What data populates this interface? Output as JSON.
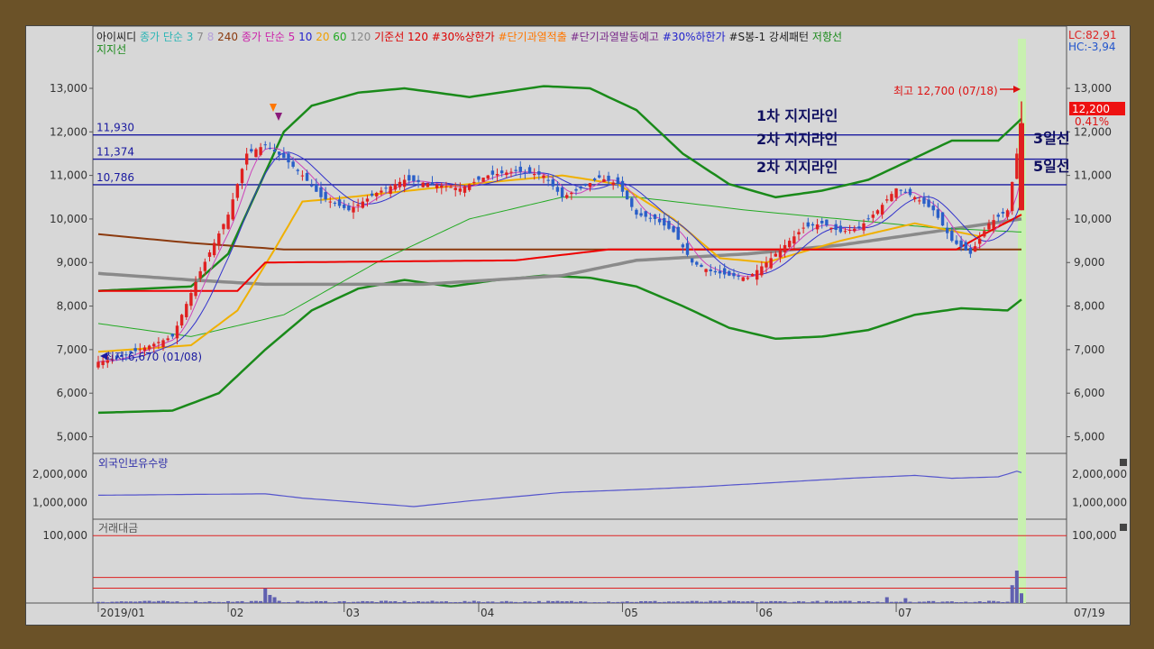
{
  "legend": {
    "items": [
      {
        "text": "아이씨디",
        "color": "#222222"
      },
      {
        "text": "종가 단순 3",
        "color": "#2db6b6"
      },
      {
        "text": "7",
        "color": "#8a8a8a"
      },
      {
        "text": "8",
        "color": "#b5a0d8"
      },
      {
        "text": "240",
        "color": "#8b3a0e"
      },
      {
        "text": "종가 단순 5",
        "color": "#cc22aa"
      },
      {
        "text": "10",
        "color": "#2222cc"
      },
      {
        "text": "20",
        "color": "#f0a000"
      },
      {
        "text": "60",
        "color": "#22aa22"
      },
      {
        "text": "120",
        "color": "#888888"
      },
      {
        "text": "기준선 120",
        "color": "#dd0000"
      },
      {
        "text": "#30%상한가",
        "color": "#dd0000"
      },
      {
        "text": "#단기과열적출",
        "color": "#ff7700"
      },
      {
        "text": "#단기과열발동예고",
        "color": "#7a2a8a"
      },
      {
        "text": "#30%하한가",
        "color": "#2222cc"
      },
      {
        "text": "#S봉-1 강세패턴",
        "color": "#222222"
      },
      {
        "text": "저항선",
        "color": "#1a8a1a"
      }
    ],
    "line2": "지지선",
    "line2_color": "#1a8a1a"
  },
  "lc_hc": {
    "lc": "LC:82,91",
    "hc": "HC:-3,94"
  },
  "price_tag": {
    "price": "12,200",
    "pct": "0.41%"
  },
  "annotations": {
    "high": "최고 12,700 (07/18)",
    "low": "최저 6,670 (01/08)",
    "support1": "1차 지지라인",
    "support2a": "2차 지지라인",
    "support2b": "2차 지지라인",
    "ma3": "3일선",
    "ma5": "5일선"
  },
  "colors": {
    "up": "#e02020",
    "down": "#2a5fc8",
    "bollinger": "#1a8a1a",
    "hline": "#1a1aa0",
    "highlight": "#c8f0b0",
    "ma240": "#8b3a0e",
    "ma120": "#8a8a8a",
    "ma20": "#f0b000",
    "ma60": "#22aa22",
    "ma10": "#3333cc",
    "ma5": "#cc44bb",
    "base": "#ee0000",
    "foreign": "#5555cc",
    "volume": "#6060b0"
  },
  "chart_data": [
    {
      "type": "candlestick",
      "title": "아이씨디",
      "ylim": [
        4700,
        13600
      ],
      "yticks": [
        "13,000",
        "12,000",
        "11,000",
        "10,000",
        "9,000",
        "8,000",
        "7,000",
        "6,000",
        "5,000"
      ],
      "ytick_values": [
        13000,
        12000,
        11000,
        10000,
        9000,
        8000,
        7000,
        6000,
        5000
      ],
      "xticks": [
        "2019/01",
        "02",
        "03",
        "04",
        "05",
        "06",
        "07"
      ],
      "right_xtick": "07/19",
      "support_levels": [
        {
          "label": "11,930",
          "value": 11930
        },
        {
          "label": "11,374",
          "value": 11374
        },
        {
          "label": "10,786",
          "value": 10786
        }
      ],
      "last_price": 12200,
      "high": 12700,
      "low": 6670,
      "close_series_waypoints": [
        [
          0,
          6720
        ],
        [
          4,
          6800
        ],
        [
          10,
          7050
        ],
        [
          16,
          7300
        ],
        [
          22,
          8800
        ],
        [
          28,
          10100
        ],
        [
          32,
          11500
        ],
        [
          36,
          11700
        ],
        [
          40,
          11400
        ],
        [
          44,
          11000
        ],
        [
          48,
          10500
        ],
        [
          54,
          10200
        ],
        [
          60,
          10600
        ],
        [
          66,
          10900
        ],
        [
          72,
          10800
        ],
        [
          78,
          10700
        ],
        [
          84,
          11000
        ],
        [
          90,
          11100
        ],
        [
          96,
          11000
        ],
        [
          100,
          10500
        ],
        [
          104,
          10700
        ],
        [
          108,
          10950
        ],
        [
          112,
          10800
        ],
        [
          116,
          10100
        ],
        [
          120,
          10000
        ],
        [
          124,
          9700
        ],
        [
          128,
          9000
        ],
        [
          132,
          8800
        ],
        [
          136,
          8700
        ],
        [
          140,
          8650
        ],
        [
          144,
          9000
        ],
        [
          148,
          9400
        ],
        [
          152,
          9800
        ],
        [
          156,
          9900
        ],
        [
          160,
          9700
        ],
        [
          164,
          9800
        ],
        [
          168,
          10200
        ],
        [
          172,
          10700
        ],
        [
          176,
          10500
        ],
        [
          180,
          10200
        ],
        [
          184,
          9500
        ],
        [
          188,
          9200
        ],
        [
          192,
          9900
        ],
        [
          196,
          10200
        ],
        [
          198,
          11500
        ],
        [
          199,
          12200
        ]
      ],
      "bollinger_upper_waypoints": [
        [
          0,
          8350
        ],
        [
          20,
          8450
        ],
        [
          28,
          9200
        ],
        [
          34,
          10600
        ],
        [
          40,
          12000
        ],
        [
          46,
          12600
        ],
        [
          56,
          12900
        ],
        [
          66,
          13000
        ],
        [
          80,
          12800
        ],
        [
          96,
          13050
        ],
        [
          106,
          13000
        ],
        [
          116,
          12500
        ],
        [
          126,
          11500
        ],
        [
          136,
          10800
        ],
        [
          146,
          10500
        ],
        [
          156,
          10650
        ],
        [
          166,
          10900
        ],
        [
          176,
          11400
        ],
        [
          184,
          11800
        ],
        [
          194,
          11800
        ],
        [
          199,
          12300
        ]
      ],
      "bollinger_lower_waypoints": [
        [
          0,
          5550
        ],
        [
          16,
          5600
        ],
        [
          26,
          6000
        ],
        [
          36,
          7000
        ],
        [
          46,
          7900
        ],
        [
          56,
          8400
        ],
        [
          66,
          8600
        ],
        [
          76,
          8450
        ],
        [
          86,
          8600
        ],
        [
          96,
          8700
        ],
        [
          106,
          8650
        ],
        [
          116,
          8450
        ],
        [
          126,
          8000
        ],
        [
          136,
          7500
        ],
        [
          146,
          7250
        ],
        [
          156,
          7300
        ],
        [
          166,
          7450
        ],
        [
          176,
          7800
        ],
        [
          186,
          7950
        ],
        [
          196,
          7900
        ],
        [
          199,
          8150
        ]
      ],
      "ma240_waypoints": [
        [
          0,
          9650
        ],
        [
          20,
          9450
        ],
        [
          40,
          9300
        ],
        [
          100,
          9300
        ],
        [
          199,
          9300
        ]
      ],
      "ma120_waypoints": [
        [
          0,
          8750
        ],
        [
          20,
          8600
        ],
        [
          36,
          8500
        ],
        [
          70,
          8500
        ],
        [
          100,
          8700
        ],
        [
          116,
          9050
        ],
        [
          140,
          9200
        ],
        [
          160,
          9400
        ],
        [
          199,
          10000
        ]
      ],
      "ma20_waypoints": [
        [
          0,
          6950
        ],
        [
          20,
          7100
        ],
        [
          30,
          7900
        ],
        [
          38,
          9300
        ],
        [
          44,
          10400
        ],
        [
          54,
          10500
        ],
        [
          80,
          10800
        ],
        [
          100,
          11000
        ],
        [
          112,
          10800
        ],
        [
          124,
          10000
        ],
        [
          134,
          9100
        ],
        [
          144,
          9000
        ],
        [
          160,
          9500
        ],
        [
          176,
          9900
        ],
        [
          190,
          9600
        ],
        [
          199,
          10100
        ]
      ],
      "ma60_waypoints": [
        [
          0,
          7600
        ],
        [
          20,
          7300
        ],
        [
          40,
          7800
        ],
        [
          60,
          9000
        ],
        [
          80,
          10000
        ],
        [
          100,
          10500
        ],
        [
          116,
          10500
        ],
        [
          140,
          10200
        ],
        [
          160,
          10000
        ],
        [
          180,
          9800
        ],
        [
          199,
          9700
        ]
      ],
      "base_waypoints": [
        [
          0,
          8350
        ],
        [
          30,
          8350
        ],
        [
          36,
          9000
        ],
        [
          90,
          9050
        ],
        [
          110,
          9300
        ],
        [
          150,
          9300
        ],
        [
          185,
          9300
        ],
        [
          190,
          9600
        ],
        [
          199,
          10100
        ]
      ],
      "volume_spikes": [
        [
          36,
          0.45
        ],
        [
          37,
          0.25
        ],
        [
          38,
          0.18
        ],
        [
          170,
          0.18
        ],
        [
          174,
          0.15
        ],
        [
          197,
          0.55
        ],
        [
          198,
          1.0
        ],
        [
          199,
          0.3
        ]
      ]
    },
    {
      "type": "line",
      "title": "외국인보유수량",
      "yticks": [
        "2,000,000",
        "1,000,000"
      ],
      "ytick_values": [
        2000000,
        1000000
      ],
      "ylim": [
        500000,
        2600000
      ],
      "waypoints": [
        [
          0,
          1250000
        ],
        [
          20,
          1280000
        ],
        [
          36,
          1300000
        ],
        [
          44,
          1150000
        ],
        [
          60,
          950000
        ],
        [
          68,
          850000
        ],
        [
          80,
          1050000
        ],
        [
          100,
          1350000
        ],
        [
          116,
          1450000
        ],
        [
          130,
          1550000
        ],
        [
          146,
          1700000
        ],
        [
          162,
          1850000
        ],
        [
          176,
          1950000
        ],
        [
          184,
          1850000
        ],
        [
          194,
          1900000
        ],
        [
          198,
          2100000
        ],
        [
          199,
          2050000
        ]
      ]
    },
    {
      "type": "bar",
      "title": "거래대금",
      "yticks": [
        "100,000"
      ],
      "ytick_values": [
        100000
      ],
      "ylim": [
        0,
        115000
      ]
    }
  ]
}
